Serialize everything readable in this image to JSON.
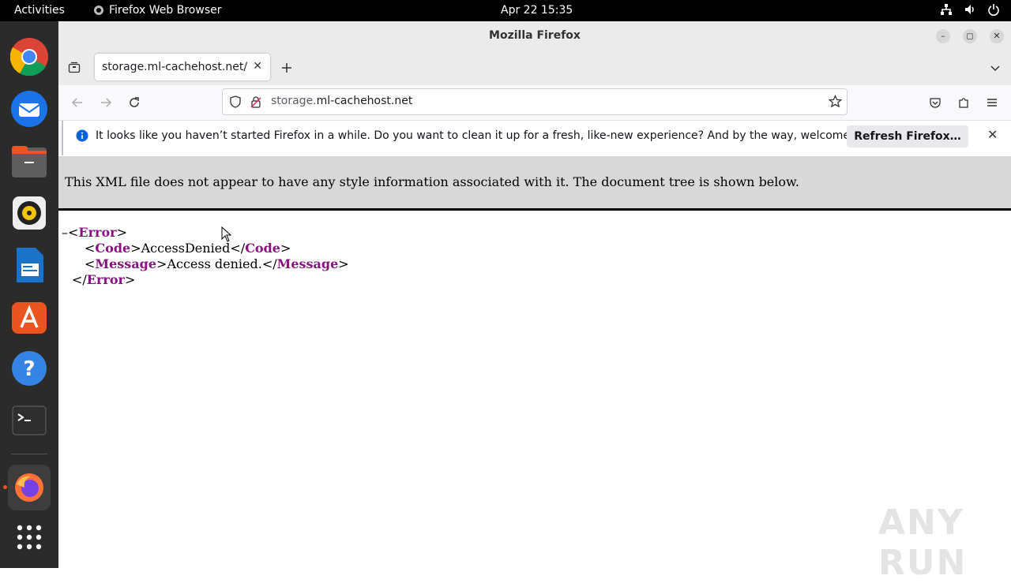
{
  "system_bar": {
    "activities": "Activities",
    "app_name": "Firefox Web Browser",
    "clock": "Apr 22  15:35"
  },
  "dock": {
    "apps": [
      "chrome-icon",
      "thunderbird-icon",
      "files-icon",
      "rhythmbox-icon",
      "writer-icon",
      "app-center-icon",
      "help-icon",
      "terminal-icon",
      "firefox-icon",
      "show-apps-icon"
    ]
  },
  "window": {
    "title": "Mozilla Firefox"
  },
  "tabs": [
    {
      "label": "storage.ml-cachehost.net/"
    }
  ],
  "url": {
    "prefix": "storage.",
    "domain": "ml-cachehost.net"
  },
  "notification": {
    "message": "It looks like you haven’t started Firefox in a while. Do you want to clean it up for a fresh, like-new experience? And by the way, welcome back!",
    "button": "Refresh Firefox…"
  },
  "xml_viewer": {
    "header": "This XML file does not appear to have any style information associated with it. The document tree is shown below.",
    "collapse_marker": "–",
    "root_tag": "Error",
    "code_tag": "Code",
    "code_value": "AccessDenied",
    "message_tag": "Message",
    "message_value": "Access denied."
  },
  "watermark": "ANY RUN"
}
